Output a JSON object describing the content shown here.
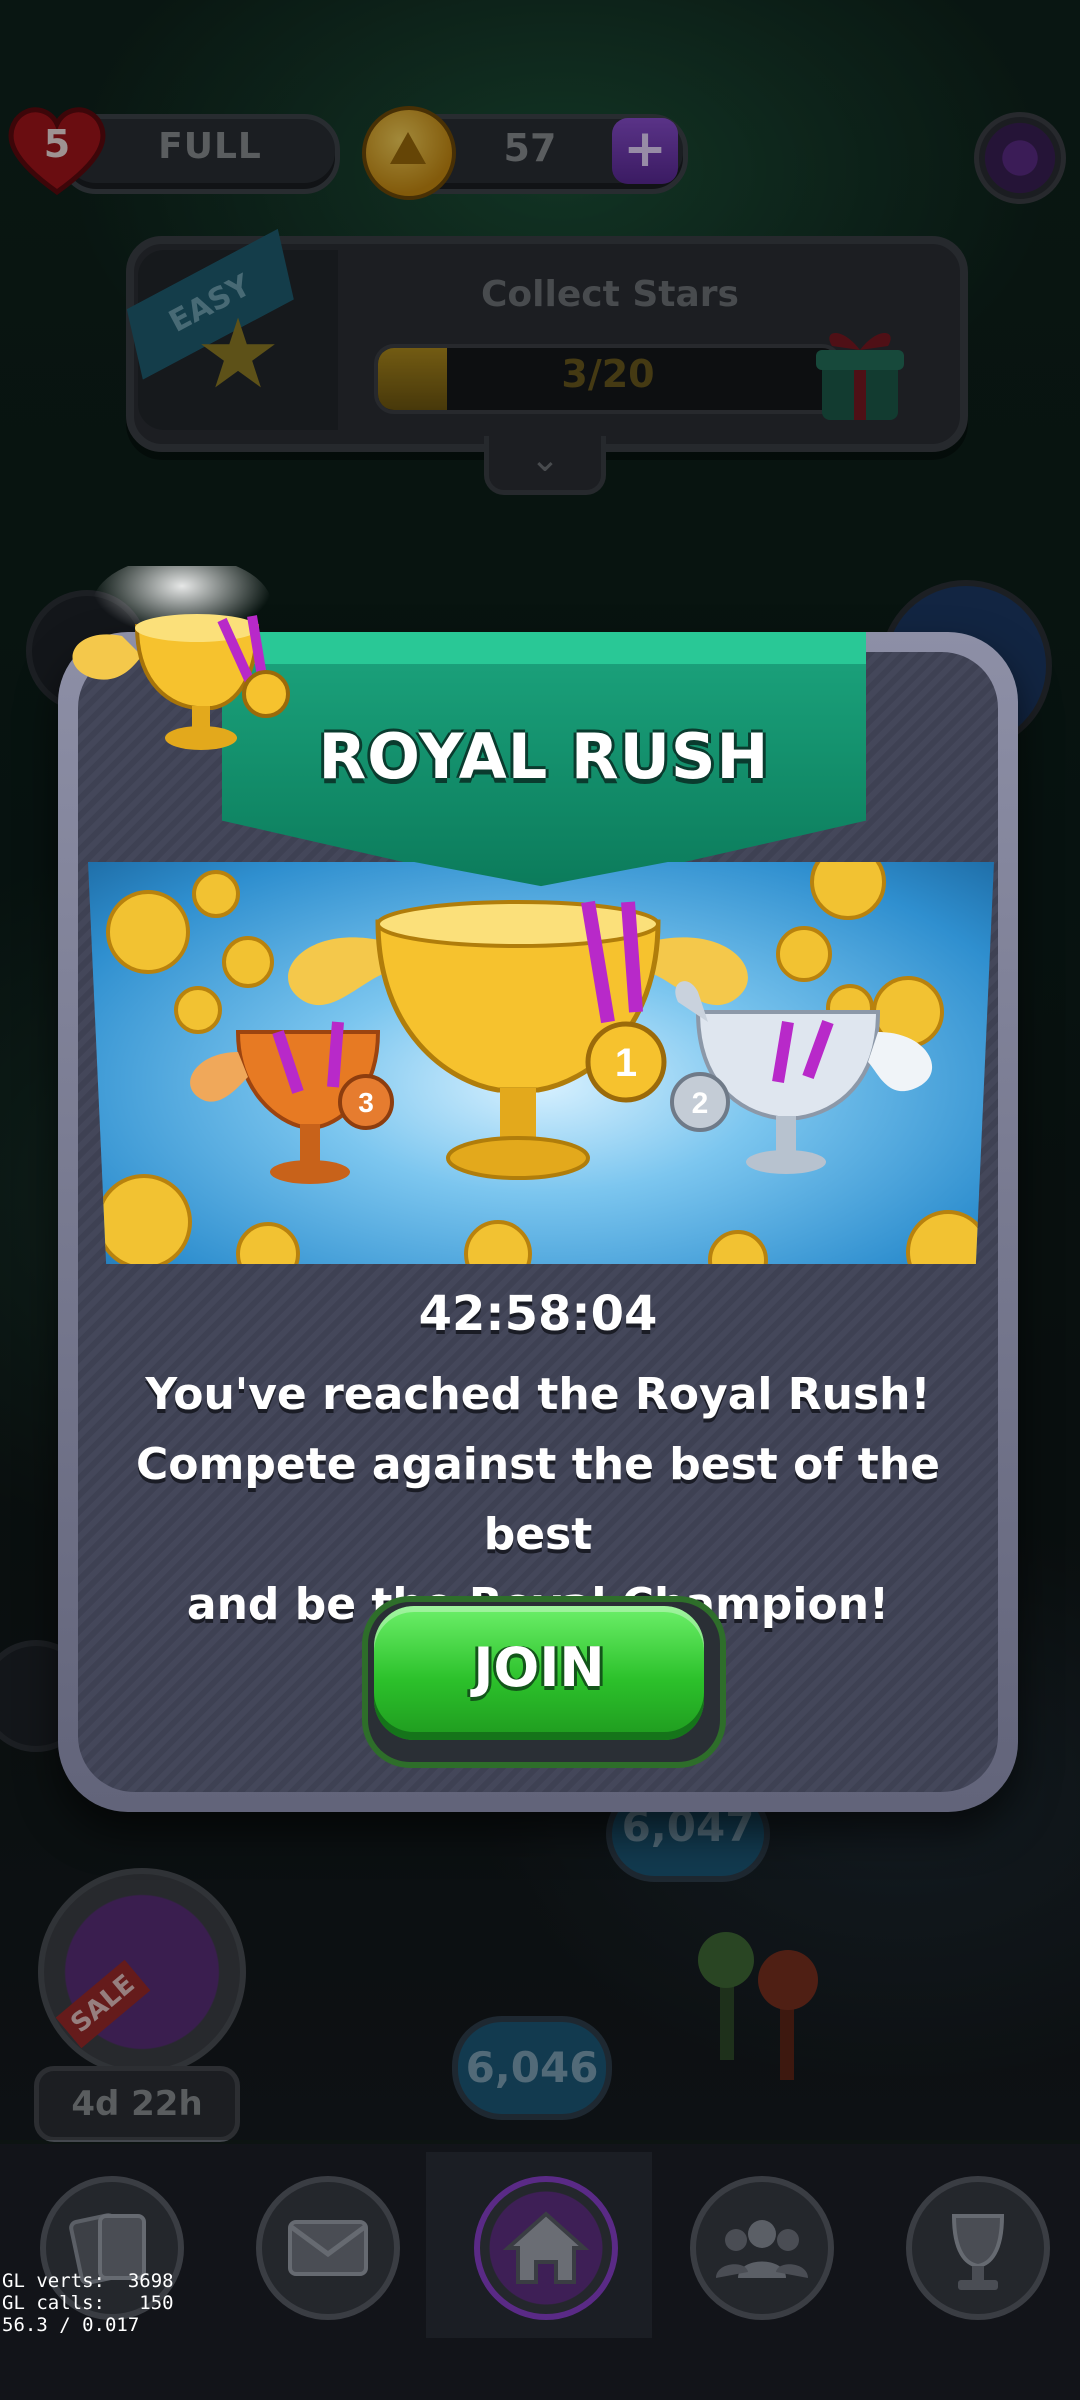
{
  "top_bar": {
    "lives_count": "5",
    "lives_status": "FULL",
    "coins": "57",
    "plus_label": "+"
  },
  "quest": {
    "difficulty": "EASY",
    "title": "Collect Stars",
    "progress_text": "3/20",
    "progress_fraction": 0.15
  },
  "modal": {
    "title": "ROYAL RUSH",
    "timer": "42:58:04",
    "description_lines": [
      "You've reached the Royal Rush!",
      "Compete against the best of the best",
      "and be the Royal Champion!"
    ],
    "join_label": "JOIN",
    "medals": [
      "1",
      "2",
      "3"
    ]
  },
  "background": {
    "offer_tag": "SALE",
    "offer_timer": "4d 22h",
    "score_a": "6,046",
    "score_b": "6,047"
  },
  "nav": {
    "items": [
      "cards-icon",
      "mail-icon",
      "home-icon",
      "team-icon",
      "trophy-icon"
    ],
    "active": "home-icon"
  },
  "debug": {
    "line1": "GL verts:  3698",
    "line2": "GL calls:   150",
    "line3": "56.3 / 0.017"
  },
  "colors": {
    "banner_green": "#1ca57e",
    "join_green": "#2cc12b",
    "panel_gray": "#44475a",
    "accent_purple": "#8a4fd0"
  }
}
